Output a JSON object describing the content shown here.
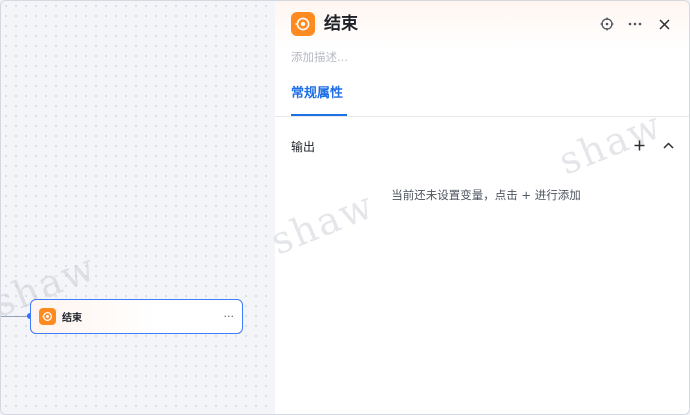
{
  "canvas": {
    "node": {
      "title": "结束",
      "more": "···"
    },
    "watermark": "shaw"
  },
  "panel": {
    "title": "结束",
    "description_placeholder": "添加描述...",
    "tabs": [
      {
        "label": "常规属性",
        "active": true
      }
    ],
    "section": {
      "title": "输出"
    },
    "empty_hint": "当前还未设置变量，点击 + 进行添加"
  },
  "colors": {
    "accent": "#1f6fe5",
    "node_icon": "#ff8a1f",
    "node_border": "#3d7bff"
  }
}
